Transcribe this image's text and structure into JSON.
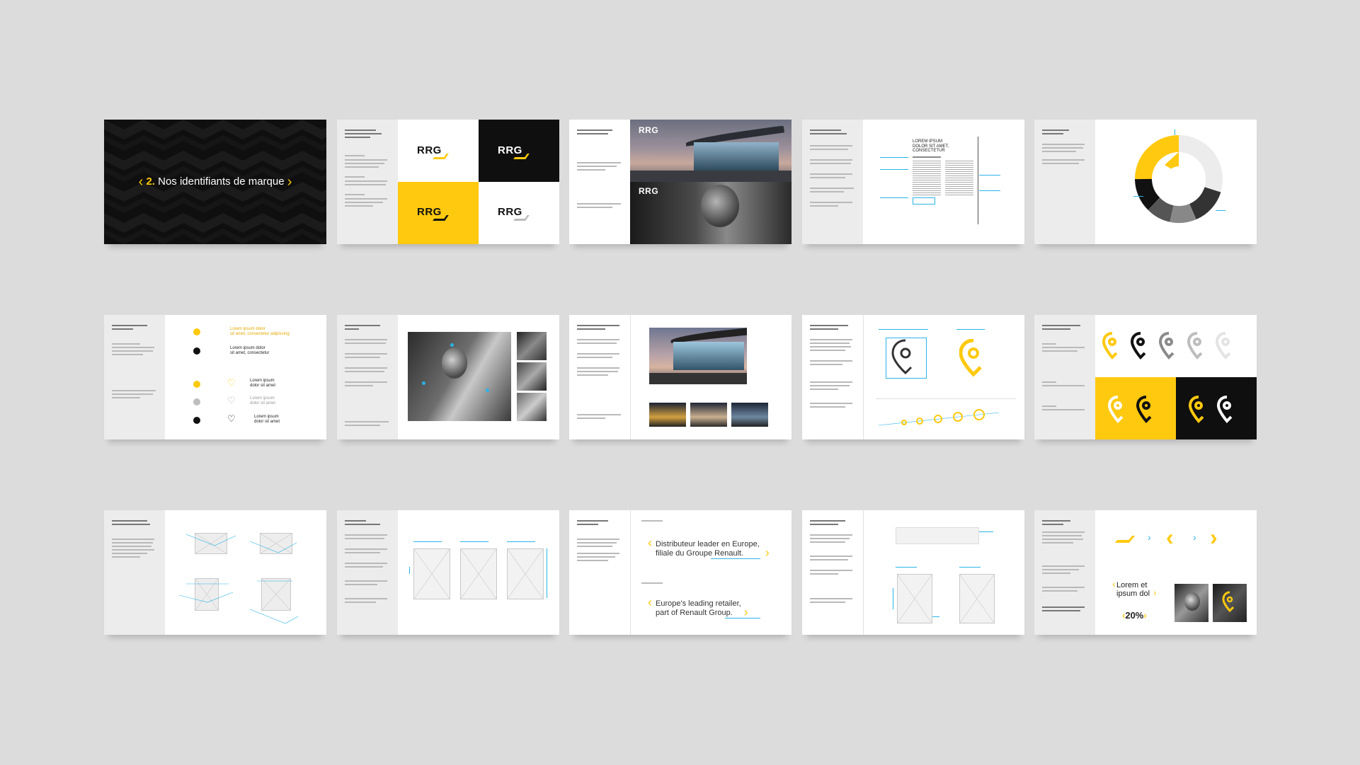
{
  "colors": {
    "yellow": "#ffc90f",
    "black": "#111111",
    "cyan": "#2ab3e8",
    "background": "#dcdcdc"
  },
  "slide01": {
    "number": "2.",
    "title": "Nos identifiants de marque"
  },
  "logos": {
    "wordmark": "RRG"
  },
  "slide04": {
    "headline_l1": "LOREM IPSUM",
    "headline_l2": "DOLOR SIT AMET,",
    "headline_l3": "CONSECTETUR"
  },
  "slide06": {
    "label1_l1": "Lorem ipsum dolor",
    "label1_l2": "sit amet, consectetur adipiscing",
    "label2_l1": "Lorem ipsum dolor",
    "label2_l2": "sit amet, consectetur",
    "heart1": "Lorem ipsum dolor sit amet",
    "heart2": "Lorem ipsum dolor sit amet",
    "heart3": "Lorem ipsum dolor sit amet"
  },
  "slide13": {
    "quote_fr_l1": "Distributeur leader en Europe,",
    "quote_fr_l2": "filiale du Groupe Renault.",
    "quote_en_l1": "Europe's leading retailer,",
    "quote_en_l2": "part of Renault Group."
  },
  "slide15": {
    "lorem_l1": "Lorem et",
    "lorem_l2": "ipsum dol",
    "percent": "20%"
  },
  "icons": {
    "pattern": "chevron-pattern",
    "chevron": "chevron-icon",
    "pin": "pin-icon",
    "heart": "heart-icon",
    "dot": "dot-icon"
  }
}
